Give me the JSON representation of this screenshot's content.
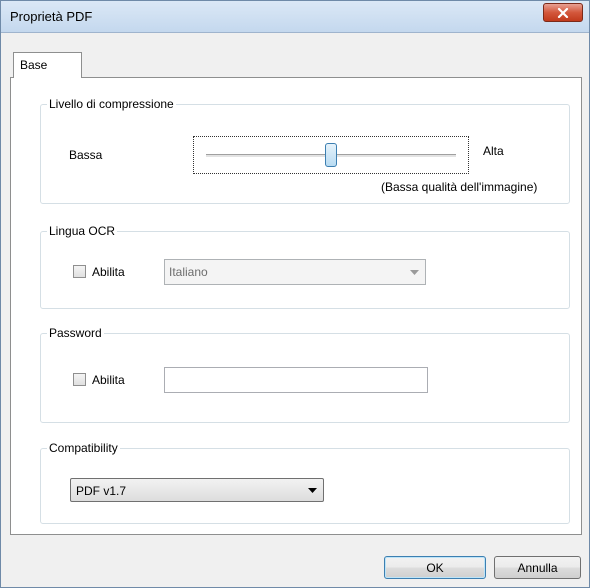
{
  "window": {
    "title": "Proprietà PDF"
  },
  "tabs": [
    {
      "label": "Base",
      "selected": true
    }
  ],
  "compression": {
    "group_label": "Livello di compressione",
    "low_label": "Bassa",
    "high_label": "Alta",
    "status_text": "(Bassa qualità dell'immagine)",
    "level": 0.5
  },
  "ocr": {
    "group_label": "Lingua OCR",
    "enable_label": "Abilita",
    "enabled": false,
    "language_selected": "Italiano"
  },
  "password": {
    "group_label": "Password",
    "enable_label": "Abilita",
    "enabled": false,
    "value": ""
  },
  "compatibility": {
    "group_label": "Compatibility",
    "selected": "PDF v1.7"
  },
  "buttons": {
    "ok_label": "OK",
    "cancel_label": "Annulla"
  },
  "colors": {
    "accent": "#3c7fb1",
    "close_button": "#c13a1c"
  }
}
